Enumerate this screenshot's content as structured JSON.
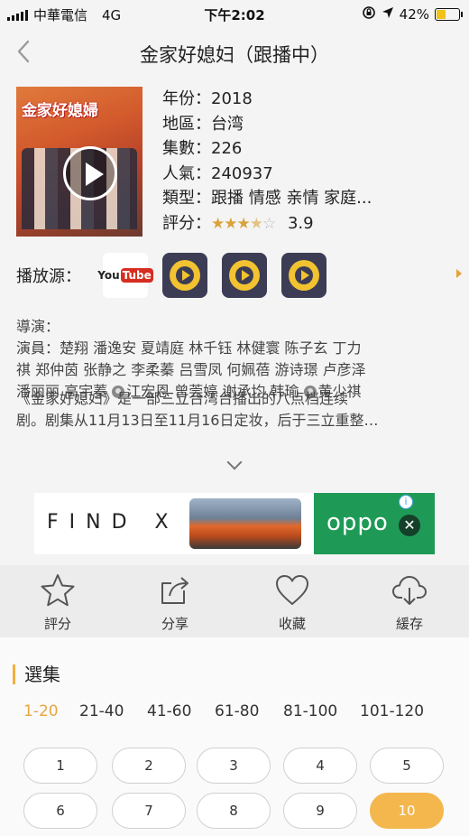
{
  "status": {
    "carrier": "中華電信",
    "network": "4G",
    "time": "下午2:02",
    "battery": "42%",
    "battery_level": 0.42
  },
  "nav": {
    "title": "金家好媳妇（跟播中）"
  },
  "poster": {
    "banner_text": "金家好媳婦"
  },
  "info": {
    "year": "年份：2018",
    "region": "地區：台湾",
    "episodes": "集數：226",
    "popularity": "人氣：240937",
    "genre": "類型：跟播 情感 亲情 家庭...",
    "rating_label": "評分：",
    "rating_value": "3.9",
    "rating_stars": 3.5
  },
  "sources": {
    "label": "播放源：",
    "items": [
      "YouTube",
      "qq-player-1",
      "qq-player-2",
      "qq-player-3"
    ]
  },
  "credits": {
    "director": "導演：",
    "cast_line1": "演員：楚翔 潘逸安 夏靖庭 林千钰 林健寰 陈子玄 丁力",
    "cast_line2": "祺 郑仲茵 张静之 李柔蓁 吕雪凤 何姵蓓 游诗璟 卢彦泽",
    "cast_line3a": "潘丽丽 高宇蓁 ",
    "cast_line3b": "江宏恩 曾莞婷 谢承均 韩瑜 ",
    "cast_line3c": "黄少祺"
  },
  "synopsis": {
    "line1": "《金家好媳妇》是一部三立台湾台播出的八点档连续",
    "line2": "剧。剧集从11月13日至11月16日定妆，后于三立重整…"
  },
  "ad": {
    "left_text": "FIND X",
    "right_text": "oppo",
    "info_mark": "i",
    "close_mark": "✕"
  },
  "actions": [
    {
      "label": "評分",
      "icon": "star-icon"
    },
    {
      "label": "分享",
      "icon": "share-icon"
    },
    {
      "label": "收藏",
      "icon": "heart-icon"
    },
    {
      "label": "緩存",
      "icon": "cloud-download-icon"
    }
  ],
  "episodes": {
    "title": "選集",
    "ranges": [
      "1-20",
      "21-40",
      "41-60",
      "61-80",
      "81-100",
      "101-120"
    ],
    "active_range": 0,
    "numbers": [
      "1",
      "2",
      "3",
      "4",
      "5",
      "6",
      "7",
      "8",
      "9",
      "10"
    ],
    "active_episode": 9
  },
  "colors": {
    "accent": "#f3b74e",
    "star": "#d9a23b",
    "oppo_green": "#1f9a56"
  }
}
